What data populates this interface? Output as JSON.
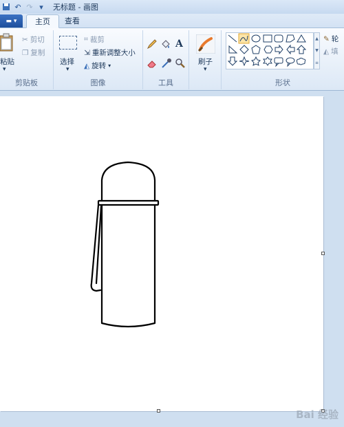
{
  "window": {
    "title": "无标题 - 画图"
  },
  "tabs": [
    {
      "label": "主页",
      "active": true
    },
    {
      "label": "查看",
      "active": false
    }
  ],
  "clipboard": {
    "paste": "粘贴",
    "cut": "剪切",
    "copy": "复制",
    "label": "剪贴板"
  },
  "image": {
    "select": "选择",
    "crop": "裁剪",
    "resize": "重新调整大小",
    "rotate": "旋转",
    "label": "图像"
  },
  "tools": {
    "label": "工具"
  },
  "brushes": {
    "label": "刷子"
  },
  "shapes": {
    "label": "形状",
    "outline": "轮",
    "fill": "填"
  },
  "watermark": "Bai 经验",
  "colors": {
    "accent": "#f5c04f",
    "ribbon": "#dce8f6",
    "workspace": "#cfdff0",
    "canvas": "#ffffff"
  }
}
